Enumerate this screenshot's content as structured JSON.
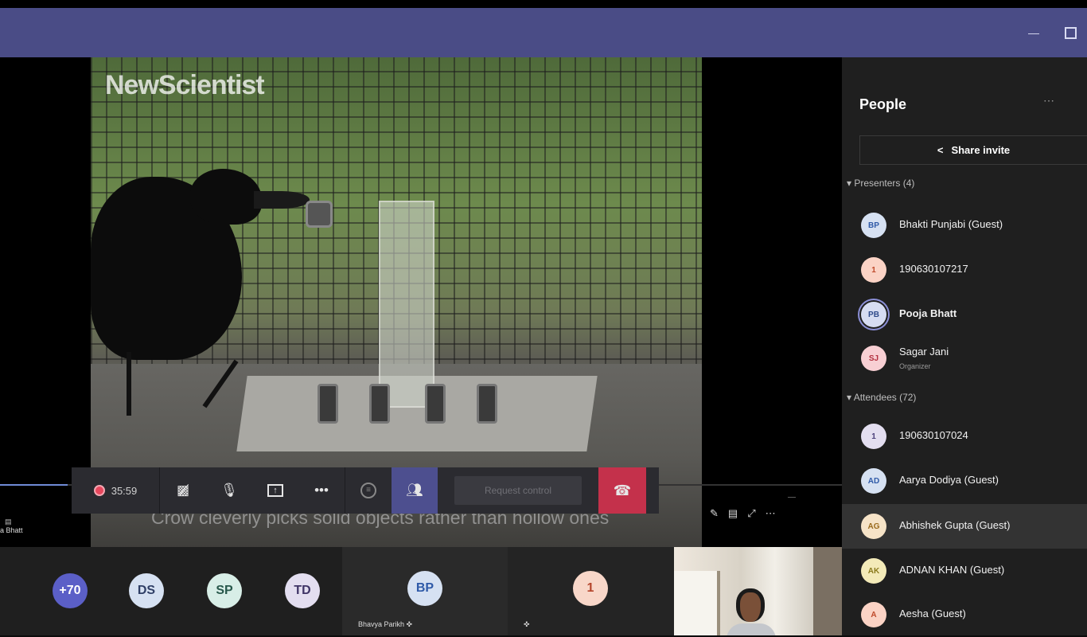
{
  "window": {
    "minimize_icon": "minimize-icon",
    "restore_icon": "restore-icon"
  },
  "stage": {
    "watermark": "NewScientist",
    "caption": "Crow cleverly picks solid objects rather than hollow ones",
    "presenter_name": "a Bhatt",
    "progress_fraction": 0.08
  },
  "toolbar": {
    "timer": "35:59",
    "request_control_label": "Request control",
    "icons": [
      "record-dot-icon",
      "camera-off-icon",
      "mic-off-icon",
      "share-screen-icon",
      "more-icon",
      "chat-icon",
      "people-icon",
      "hang-up-icon"
    ]
  },
  "gallery": {
    "avatars": [
      {
        "initials": "+70",
        "bg": "#5b5fc7",
        "fg": "#ffffff"
      },
      {
        "initials": "DS",
        "bg": "#d6e1f2",
        "fg": "#2f3f66"
      },
      {
        "initials": "SP",
        "bg": "#d8eee7",
        "fg": "#27584b"
      },
      {
        "initials": "TD",
        "bg": "#e3def0",
        "fg": "#3f3466"
      }
    ],
    "tiles": [
      {
        "initials": "BP",
        "name": "Bhavya Parikh",
        "bg": "#d6e1f2",
        "fg": "#2f5aa8"
      },
      {
        "initials": "1",
        "name": "",
        "bg": "#f8d7c9",
        "fg": "#b4442b"
      }
    ]
  },
  "panel": {
    "title": "People",
    "share_invite_label": "Share invite",
    "presenters_header": "Presenters (4)",
    "attendees_header": "Attendees (72)",
    "presenters": [
      {
        "initials": "BP",
        "name": "Bhakti Punjabi (Guest)",
        "bg": "#d6e1f2",
        "fg": "#2f5aa8"
      },
      {
        "initials": "1",
        "name": "190630107217",
        "bg": "#fbd3c5",
        "fg": "#c04a2b"
      },
      {
        "initials": "PB",
        "name": "Pooja Bhatt",
        "bg": "#d6dcf2",
        "fg": "#2f4a8a",
        "bold": true
      },
      {
        "initials": "SJ",
        "name": "Sagar Jani",
        "role": "Organizer",
        "bg": "#f8cfd3",
        "fg": "#b3303f"
      }
    ],
    "attendees": [
      {
        "initials": "1",
        "name": "190630107024",
        "bg": "#e3def0",
        "fg": "#4a3f7a"
      },
      {
        "initials": "AD",
        "name": "Aarya Dodiya (Guest)",
        "bg": "#d6e1f2",
        "fg": "#2f5aa8"
      },
      {
        "initials": "AG",
        "name": "Abhishek Gupta (Guest)",
        "bg": "#f6e3c7",
        "fg": "#9a6a1c"
      },
      {
        "initials": "AK",
        "name": "ADNAN KHAN (Guest)",
        "bg": "#f3eab8",
        "fg": "#8a7a1c"
      },
      {
        "initials": "A",
        "name": "Aesha (Guest)",
        "bg": "#fbd3c5",
        "fg": "#c04a2b"
      }
    ]
  }
}
